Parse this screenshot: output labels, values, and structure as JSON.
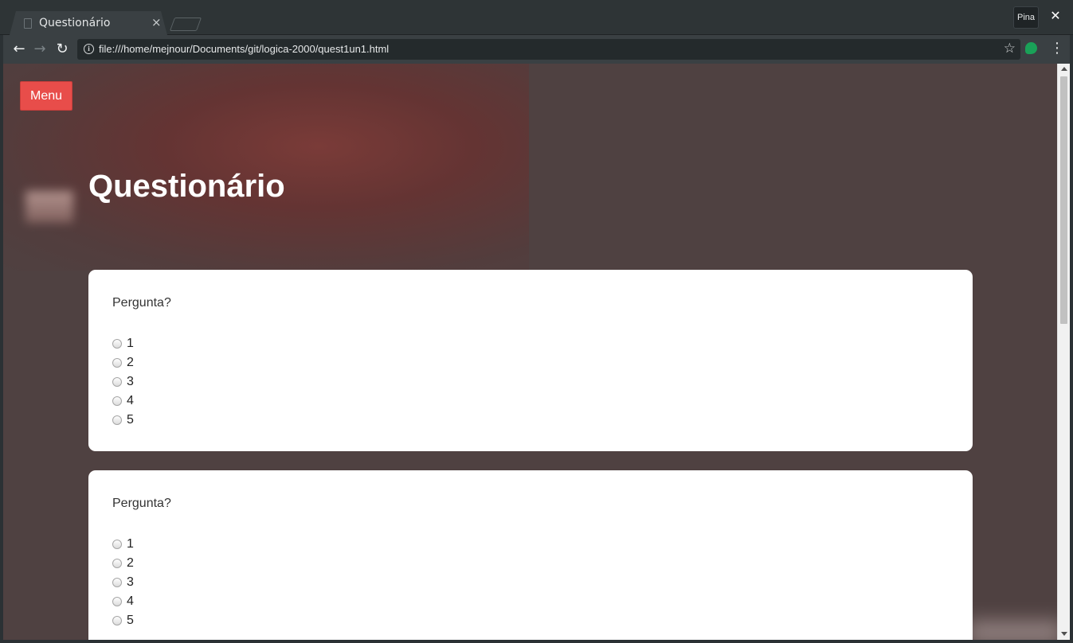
{
  "browser": {
    "tab_title": "Questionário",
    "tab_close": "×",
    "pin_label": "Pina",
    "close_window": "✕",
    "url": "file:///home/mejnour/Documents/git/logica-2000/quest1un1.html",
    "back_glyph": "←",
    "forward_glyph": "→",
    "reload_glyph": "↻",
    "info_glyph": "i",
    "star_glyph": "☆",
    "menu_glyph": "⋮",
    "extension_color": "#1aa158"
  },
  "page": {
    "menu_button": "Menu",
    "title": "Questionário",
    "accent_color": "#e84d4a",
    "questions": [
      {
        "text": "Pergunta?",
        "options": [
          "1",
          "2",
          "3",
          "4",
          "5"
        ]
      },
      {
        "text": "Pergunta?",
        "options": [
          "1",
          "2",
          "3",
          "4",
          "5"
        ]
      }
    ]
  }
}
